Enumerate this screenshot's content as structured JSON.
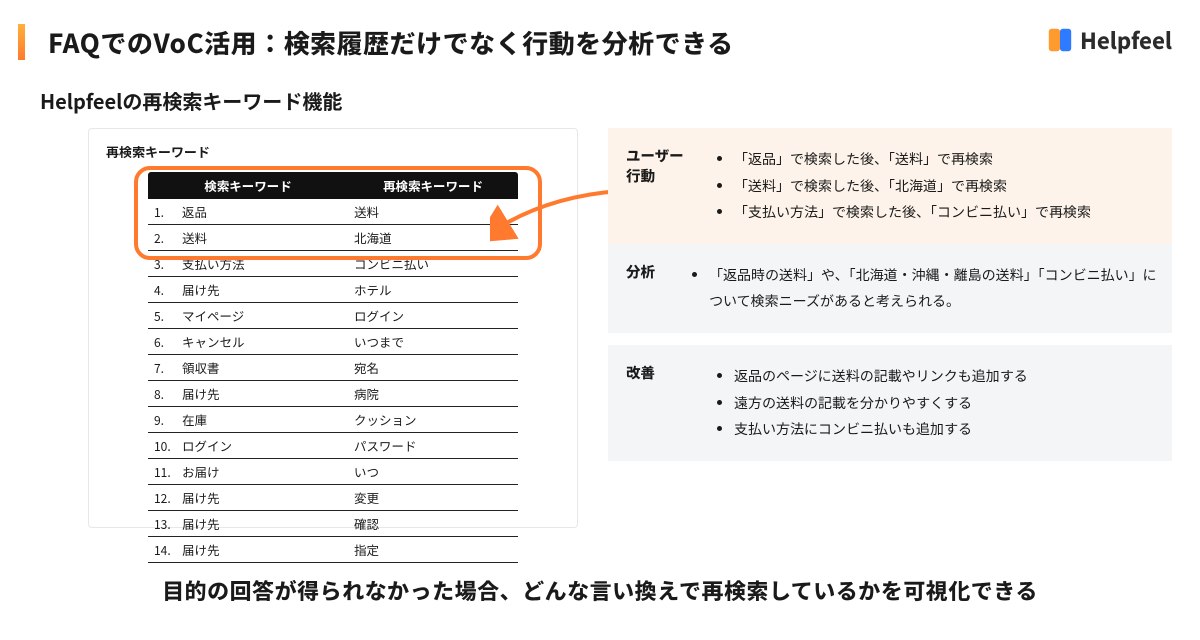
{
  "title": "FAQでのVoC活用：検索履歴だけでなく行動を分析できる",
  "brand": "Helpfeel",
  "subtitle": "Helpfeelの再検索キーワード機能",
  "panel_title": "再検索キーワード",
  "table": {
    "head": [
      "検索キーワード",
      "再検索キーワード"
    ],
    "rows": [
      [
        "1.",
        "返品",
        "送料"
      ],
      [
        "2.",
        "送料",
        "北海道"
      ],
      [
        "3.",
        "支払い方法",
        "コンビニ払い"
      ],
      [
        "4.",
        "届け先",
        "ホテル"
      ],
      [
        "5.",
        "マイページ",
        "ログイン"
      ],
      [
        "6.",
        "キャンセル",
        "いつまで"
      ],
      [
        "7.",
        "領収書",
        "宛名"
      ],
      [
        "8.",
        "届け先",
        "病院"
      ],
      [
        "9.",
        "在庫",
        "クッション"
      ],
      [
        "10.",
        "ログイン",
        "パスワード"
      ],
      [
        "11.",
        "お届け",
        "いつ"
      ],
      [
        "12.",
        "届け先",
        "変更"
      ],
      [
        "13.",
        "届け先",
        "確認"
      ],
      [
        "14.",
        "届け先",
        "指定"
      ]
    ]
  },
  "sections": [
    {
      "label": "ユーザー\n行動",
      "items": [
        "「返品」で検索した後、「送料」で再検索",
        "「送料」で検索した後、「北海道」で再検索",
        "「支払い方法」で検索した後、「コンビニ払い」で再検索"
      ]
    },
    {
      "label": "分析",
      "items": [
        "「返品時の送料」や、「北海道・沖縄・離島の送料」「コンビニ払い」について検索ニーズがあると考えられる。"
      ]
    },
    {
      "label": "改善",
      "items": [
        "返品のページに送料の記載やリンクも追加する",
        "遠方の送料の記載を分かりやすくする",
        "支払い方法にコンビニ払いも追加する"
      ]
    }
  ],
  "footer": "目的の回答が得られなかった場合、どんな言い換えで再検索しているかを可視化できる"
}
